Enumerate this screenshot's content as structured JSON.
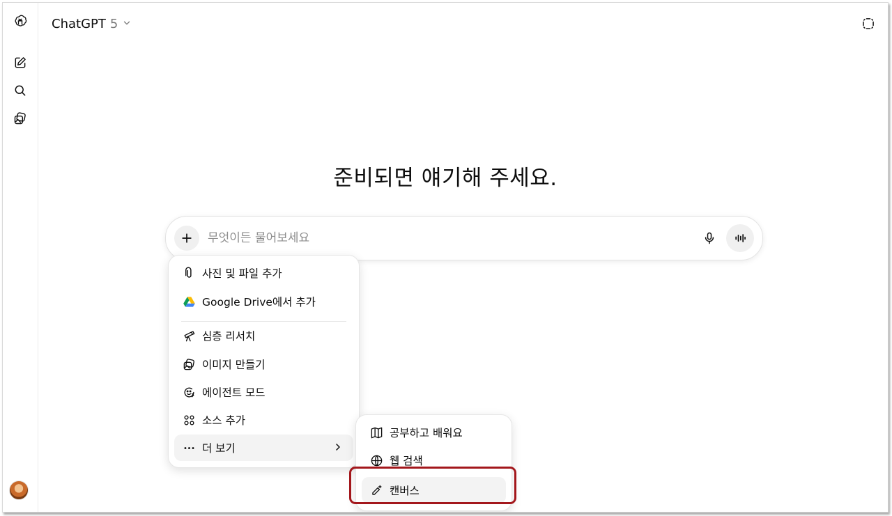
{
  "app": {
    "model_name": "ChatGPT",
    "model_version": "5"
  },
  "main": {
    "headline": "준비되면 얘기해 주세요.",
    "composer": {
      "placeholder": "무엇이든 물어보세요"
    }
  },
  "attach_menu": {
    "items": [
      {
        "label": "사진 및 파일 추가",
        "icon": "paperclip-icon"
      },
      {
        "label": "Google Drive에서 추가",
        "icon": "google-drive-icon"
      },
      {
        "label": "심층 리서치",
        "icon": "telescope-icon"
      },
      {
        "label": "이미지 만들기",
        "icon": "image-icon"
      },
      {
        "label": "에이전트 모드",
        "icon": "agent-icon"
      },
      {
        "label": "소스 추가",
        "icon": "sources-icon"
      },
      {
        "label": "더 보기",
        "icon": "more-dots-icon"
      }
    ]
  },
  "more_menu": {
    "items": [
      {
        "label": "공부하고 배워요",
        "icon": "book-icon"
      },
      {
        "label": "웹 검색",
        "icon": "globe-icon"
      },
      {
        "label": "캔버스",
        "icon": "canvas-pen-icon"
      }
    ]
  },
  "colors": {
    "highlight_border": "#a3171c",
    "hover_bg": "#f3f3f3",
    "text": "#0d0d0d",
    "placeholder": "#8e8e8e"
  }
}
